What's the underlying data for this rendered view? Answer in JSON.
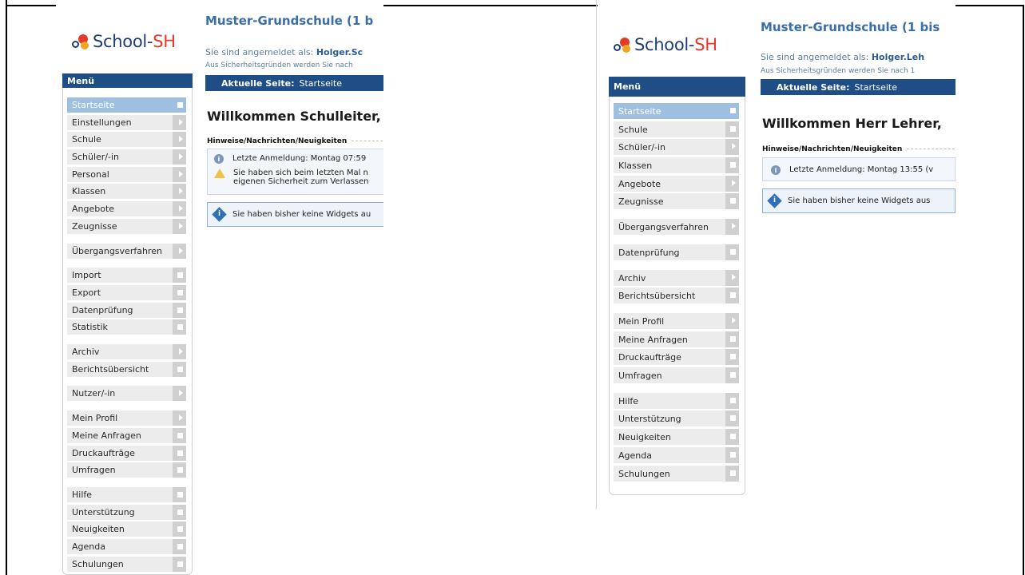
{
  "logo": {
    "part1": "School-",
    "part2": "SH"
  },
  "menu_title": "Menü",
  "left": {
    "school_title": "Muster-Grundschule (1 b",
    "login_prefix": "Sie sind angemeldet als: ",
    "login_user": "Holger.Sc",
    "security_note": "Aus Sicherheitsgründen werden Sie nach",
    "page_label": "Aktuelle Seite:",
    "page_value": "Startseite",
    "welcome": "Willkommen Schulleiter,",
    "news_heading": "Hinweise/Nachrichten/Neuigkeiten",
    "news": [
      "Letzte Anmeldung: Montag 07:59",
      "Sie haben sich beim letzten Mal n",
      "eigenen Sicherheit zum Verlassen"
    ],
    "widget_note": "Sie haben bisher keine Widgets au",
    "menu": [
      "Startseite",
      "Einstellungen",
      "Schule",
      "Schüler/-in",
      "Personal",
      "Klassen",
      "Angebote",
      "Zeugnisse",
      "Übergangsverfahren",
      "Import",
      "Export",
      "Datenprüfung",
      "Statistik",
      "Archiv",
      "Berichtsübersicht",
      "Nutzer/-in",
      "Mein Profil",
      "Meine Anfragen",
      "Druckaufträge",
      "Umfragen",
      "Hilfe",
      "Unterstützung",
      "Neuigkeiten",
      "Agenda",
      "Schulungen"
    ]
  },
  "right": {
    "school_title": "Muster-Grundschule (1 bis",
    "login_prefix": "Sie sind angemeldet als: ",
    "login_user": "Holger.Leh",
    "security_note": "Aus Sicherheitsgründen werden Sie nach 1",
    "page_label": "Aktuelle Seite:",
    "page_value": "Startseite",
    "welcome": "Willkommen Herr Lehrer,",
    "news_heading": "Hinweise/Nachrichten/Neuigkeiten",
    "news": [
      "Letzte Anmeldung: Montag 13:55 (v"
    ],
    "widget_note": "Sie haben bisher keine Widgets aus",
    "menu": [
      "Startseite",
      "Schule",
      "Schüler/-in",
      "Klassen",
      "Angebote",
      "Zeugnisse",
      "Übergangsverfahren",
      "Datenprüfung",
      "Archiv",
      "Berichtsübersicht",
      "Mein Profil",
      "Meine Anfragen",
      "Druckaufträge",
      "Umfragen",
      "Hilfe",
      "Unterstützung",
      "Neuigkeiten",
      "Agenda",
      "Schulungen"
    ]
  },
  "colors": {
    "nav_bar": "#1f4d85",
    "title_blue": "#3b6ea8",
    "active_item": "#9fbfe0",
    "menu_item_bg": "#ececec"
  }
}
